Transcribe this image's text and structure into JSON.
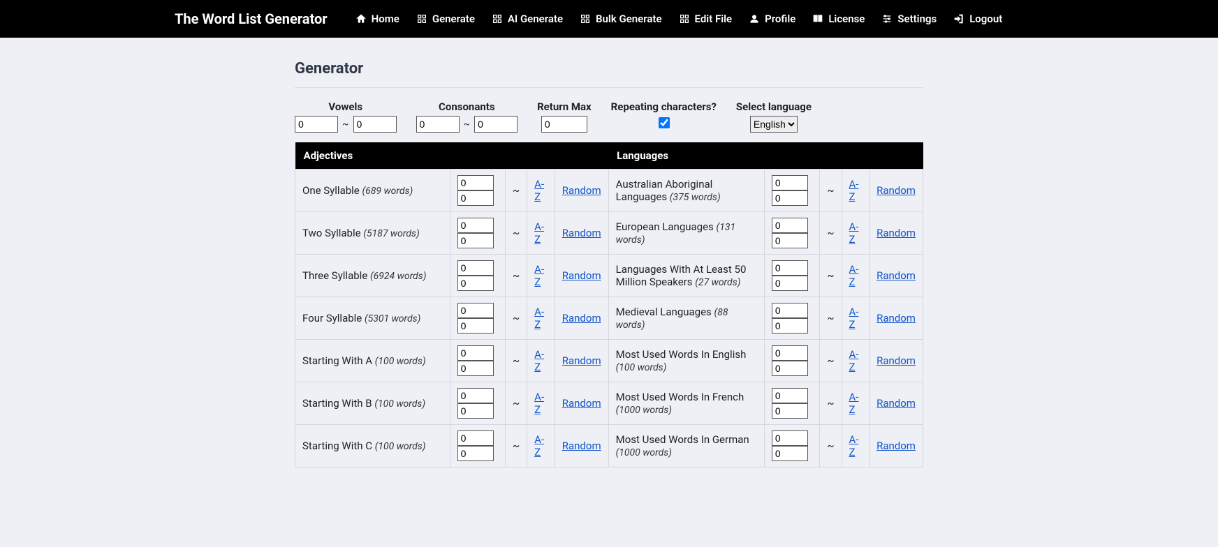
{
  "brand": "The Word List Generator",
  "nav": [
    {
      "label": "Home",
      "icon": "home"
    },
    {
      "label": "Generate",
      "icon": "cog"
    },
    {
      "label": "AI Generate",
      "icon": "cog"
    },
    {
      "label": "Bulk Generate",
      "icon": "cog"
    },
    {
      "label": "Edit File",
      "icon": "cog"
    },
    {
      "label": "Profile",
      "icon": "user"
    },
    {
      "label": "License",
      "icon": "book"
    },
    {
      "label": "Settings",
      "icon": "sliders"
    },
    {
      "label": "Logout",
      "icon": "logout"
    }
  ],
  "page_title": "Generator",
  "filters": {
    "vowels": {
      "label": "Vowels",
      "min": "0",
      "max": "0"
    },
    "consonants": {
      "label": "Consonants",
      "min": "0",
      "max": "0"
    },
    "return_max": {
      "label": "Return Max",
      "value": "0"
    },
    "repeating": {
      "label": "Repeating characters?",
      "checked": true
    },
    "language": {
      "label": "Select language",
      "value": "English",
      "options": [
        "English"
      ]
    }
  },
  "headers": {
    "left": "Adjectives",
    "right": "Languages"
  },
  "az_label": "A-Z",
  "random_label": "Random",
  "tilde": "~",
  "rows": [
    {
      "left": {
        "name": "One Syllable",
        "count": "(689 words)",
        "min": "0",
        "max": "0"
      },
      "right": {
        "name": "Australian Aboriginal Languages",
        "count": "(375 words)",
        "min": "0",
        "max": "0"
      }
    },
    {
      "left": {
        "name": "Two Syllable",
        "count": "(5187 words)",
        "min": "0",
        "max": "0"
      },
      "right": {
        "name": "European Languages",
        "count": "(131 words)",
        "min": "0",
        "max": "0"
      }
    },
    {
      "left": {
        "name": "Three Syllable",
        "count": "(6924 words)",
        "min": "0",
        "max": "0"
      },
      "right": {
        "name": "Languages With At Least 50 Million Speakers",
        "count": "(27 words)",
        "min": "0",
        "max": "0"
      }
    },
    {
      "left": {
        "name": "Four Syllable",
        "count": "(5301 words)",
        "min": "0",
        "max": "0"
      },
      "right": {
        "name": "Medieval Languages",
        "count": "(88 words)",
        "min": "0",
        "max": "0"
      }
    },
    {
      "left": {
        "name": "Starting With A",
        "count": "(100 words)",
        "min": "0",
        "max": "0"
      },
      "right": {
        "name": "Most Used Words In English",
        "count": "(100 words)",
        "min": "0",
        "max": "0"
      }
    },
    {
      "left": {
        "name": "Starting With B",
        "count": "(100 words)",
        "min": "0",
        "max": "0"
      },
      "right": {
        "name": "Most Used Words In French",
        "count": "(1000 words)",
        "min": "0",
        "max": "0"
      }
    },
    {
      "left": {
        "name": "Starting With C",
        "count": "(100 words)",
        "min": "0",
        "max": "0"
      },
      "right": {
        "name": "Most Used Words In German",
        "count": "(1000 words)",
        "min": "0",
        "max": "0"
      }
    }
  ]
}
